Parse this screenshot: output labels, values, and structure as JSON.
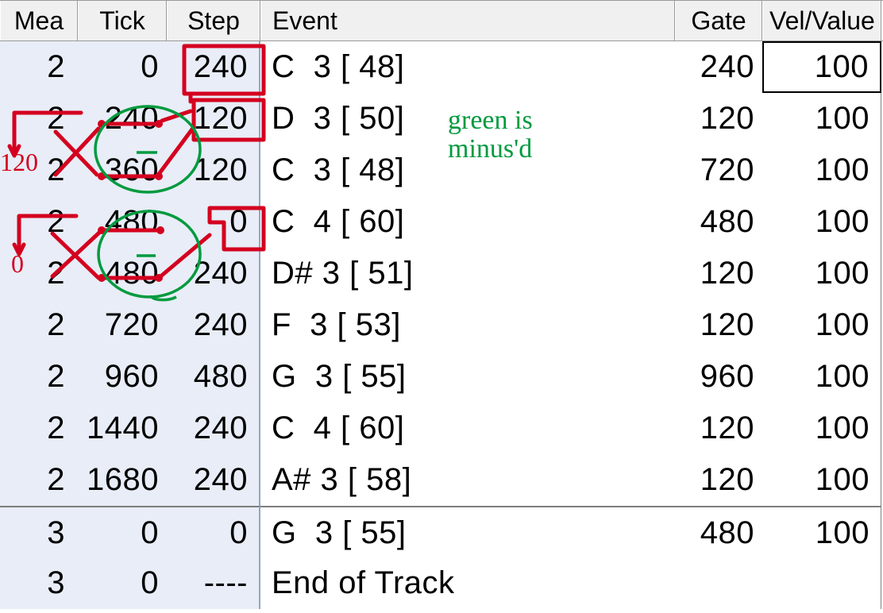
{
  "header": {
    "mea": "Mea",
    "tick": "Tick",
    "step": "Step",
    "event": "Event",
    "gate": "Gate",
    "vel": "Vel/Value"
  },
  "rows": [
    {
      "mea": "2",
      "tick": "0",
      "step": "240",
      "event": "C  3 [ 48]",
      "gate": "240",
      "vel": "100",
      "sel": true
    },
    {
      "mea": "2",
      "tick": "240",
      "step": "120",
      "event": "D  3 [ 50]",
      "gate": "120",
      "vel": "100"
    },
    {
      "mea": "2",
      "tick": "360",
      "step": "120",
      "event": "C  3 [ 48]",
      "gate": "720",
      "vel": "100"
    },
    {
      "mea": "2",
      "tick": "480",
      "step": "0",
      "event": "C  4 [ 60]",
      "gate": "480",
      "vel": "100"
    },
    {
      "mea": "2",
      "tick": "480",
      "step": "240",
      "event": "D# 3 [ 51]",
      "gate": "120",
      "vel": "100"
    },
    {
      "mea": "2",
      "tick": "720",
      "step": "240",
      "event": "F  3 [ 53]",
      "gate": "120",
      "vel": "100"
    },
    {
      "mea": "2",
      "tick": "960",
      "step": "480",
      "event": "G  3 [ 55]",
      "gate": "960",
      "vel": "100"
    },
    {
      "mea": "2",
      "tick": "1440",
      "step": "240",
      "event": "C  4 [ 60]",
      "gate": "120",
      "vel": "100"
    },
    {
      "mea": "2",
      "tick": "1680",
      "step": "240",
      "event": "A# 3 [ 58]",
      "gate": "120",
      "vel": "100"
    },
    {
      "mea": "3",
      "tick": "0",
      "step": "0",
      "event": "G  3 [ 55]",
      "gate": "480",
      "vel": "100",
      "sep": true
    },
    {
      "mea": "3",
      "tick": "0",
      "step": "----",
      "event": "End of Track",
      "gate": "",
      "vel": "",
      "muted": true
    }
  ],
  "annotation": {
    "green_text": "green\nis\nminus'd",
    "red_label_120": "120",
    "red_label_0": "0"
  }
}
